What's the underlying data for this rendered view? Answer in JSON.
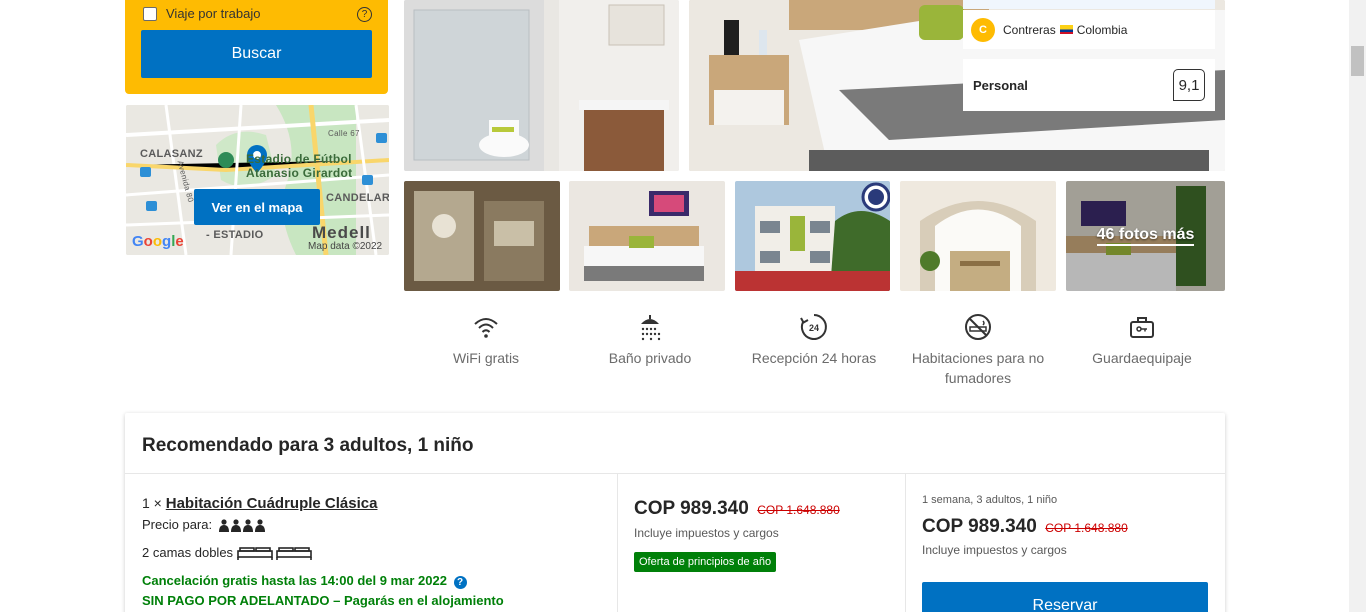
{
  "search": {
    "work_trip_label": "Viaje por trabajo",
    "help_glyph": "?",
    "search_button": "Buscar"
  },
  "map": {
    "button": "Ver en el mapa",
    "labels": {
      "calasanz": "CALASANZ",
      "stadium_line1": "Estadio de Fútbol",
      "stadium_line2": "Atanasio Girardot",
      "candelaria": "CANDELARIA",
      "estadio": "- ESTADIO",
      "calle": "Calle 67",
      "avenida": "Avenida 80",
      "medellin": "Medell",
      "google": "Google",
      "map_data": "Map data ©2022"
    }
  },
  "reviews": {
    "reviewer_initial": "C",
    "reviewer_name": "Contreras",
    "reviewer_country": "Colombia",
    "category_label": "Personal",
    "category_score": "9,1"
  },
  "photos": {
    "more_label": "46 fotos más"
  },
  "facilities": [
    {
      "icon": "wifi-icon",
      "label": "WiFi gratis"
    },
    {
      "icon": "shower-icon",
      "label": "Baño privado"
    },
    {
      "icon": "clock-24-icon",
      "label": "Recepción 24 horas"
    },
    {
      "icon": "no-smoking-icon",
      "label": "Habitaciones para no fumadores"
    },
    {
      "icon": "luggage-icon",
      "label": "Guardaequipaje"
    }
  ],
  "recommendation": {
    "title": "Recomendado para 3 adultos, 1 niño",
    "room_qty": "1 ×",
    "room_name": "Habitación Cuádruple Clásica",
    "price_for_label": "Precio para:",
    "beds": "2 camas dobles",
    "cancellation": "Cancelación gratis hasta las 14:00 del 9 mar 2022",
    "no_prepay": "SIN PAGO POR ADELANTADO – Pagarás en el alojamiento",
    "price": "COP 989.340",
    "old_price": "COP 1.648.880",
    "taxes": "Incluye impuestos y cargos",
    "deal": "Oferta de principios de año",
    "stay_summary": "1 semana, 3 adultos, 1 niño",
    "total_price": "COP 989.340",
    "total_old_price": "COP 1.648.880",
    "total_taxes": "Incluye impuestos y cargos",
    "reserve_button": "Reservar"
  }
}
